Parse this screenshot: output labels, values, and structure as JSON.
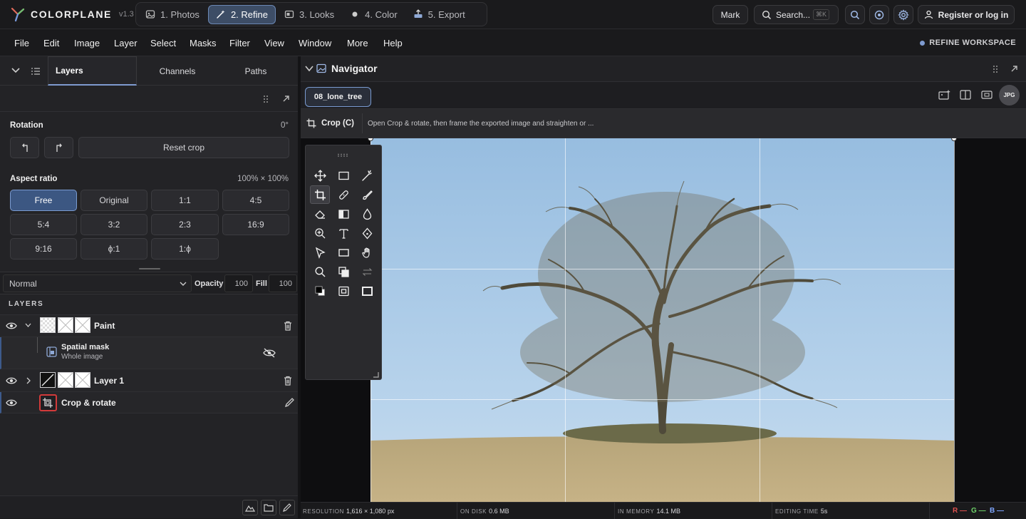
{
  "app": {
    "name": "COLORPLANE",
    "version": "v1.3"
  },
  "steps": [
    {
      "label": "1. Photos",
      "icon": "photo-icon"
    },
    {
      "label": "2. Refine",
      "icon": "wand-icon",
      "active": true
    },
    {
      "label": "3. Looks",
      "icon": "looks-icon"
    },
    {
      "label": "4. Color",
      "icon": "color-dot-icon"
    },
    {
      "label": "5. Export",
      "icon": "export-icon"
    }
  ],
  "topbar": {
    "mark_label": "Mark",
    "search_label": "Search...",
    "search_shortcut": "⌘K",
    "register_label": "Register or log in"
  },
  "menu": [
    "File",
    "Edit",
    "Image",
    "Layer",
    "Select",
    "Masks",
    "Filter",
    "View",
    "Window",
    "More",
    "Help"
  ],
  "workspace_label": "REFINE WORKSPACE",
  "left_tabs": [
    "Layers",
    "Channels",
    "Paths"
  ],
  "crop_panel": {
    "rotation_label": "Rotation",
    "rotation_value": "0°",
    "reset_label": "Reset crop",
    "aspect_label": "Aspect ratio",
    "aspect_value": "100% × 100%",
    "ratios": [
      "Free",
      "Original",
      "1:1",
      "4:5",
      "5:4",
      "3:2",
      "2:3",
      "16:9",
      "9:16",
      "ϕ:1",
      "1:ϕ"
    ],
    "selected_ratio": "Free"
  },
  "layer_controls": {
    "blend_mode": "Normal",
    "opacity_label": "Opacity",
    "opacity_value": "100",
    "fill_label": "Fill",
    "fill_value": "100"
  },
  "layers_heading": "LAYERS",
  "layers": [
    {
      "name": "Paint"
    },
    {
      "name": "Spatial mask",
      "sub": "Whole image"
    },
    {
      "name": "Layer 1"
    },
    {
      "name": "Crop & rotate"
    }
  ],
  "navigator": {
    "title": "Navigator"
  },
  "document": {
    "tab": "08_lone_tree",
    "format": "JPG"
  },
  "crop_bar": {
    "label": "Crop (C)",
    "hint": "Open Crop & rotate, then frame the exported image and straighten or ..."
  },
  "status": [
    {
      "label": "RESOLUTION",
      "value": "1,616 × 1,080 px"
    },
    {
      "label": "ON DISK",
      "value": "0.6 MB"
    },
    {
      "label": "IN MEMORY",
      "value": "14.1 MB"
    },
    {
      "label": "EDITING TIME",
      "value": "5s"
    }
  ],
  "channels": [
    {
      "label": "R",
      "value": "—",
      "color": "#e0524f"
    },
    {
      "label": "G",
      "value": "—",
      "color": "#6fd36a"
    },
    {
      "label": "B",
      "value": "—",
      "color": "#7fa6ff"
    }
  ],
  "colors": {
    "accent": "#7f9bd0",
    "selected_button": "#3c5782"
  }
}
